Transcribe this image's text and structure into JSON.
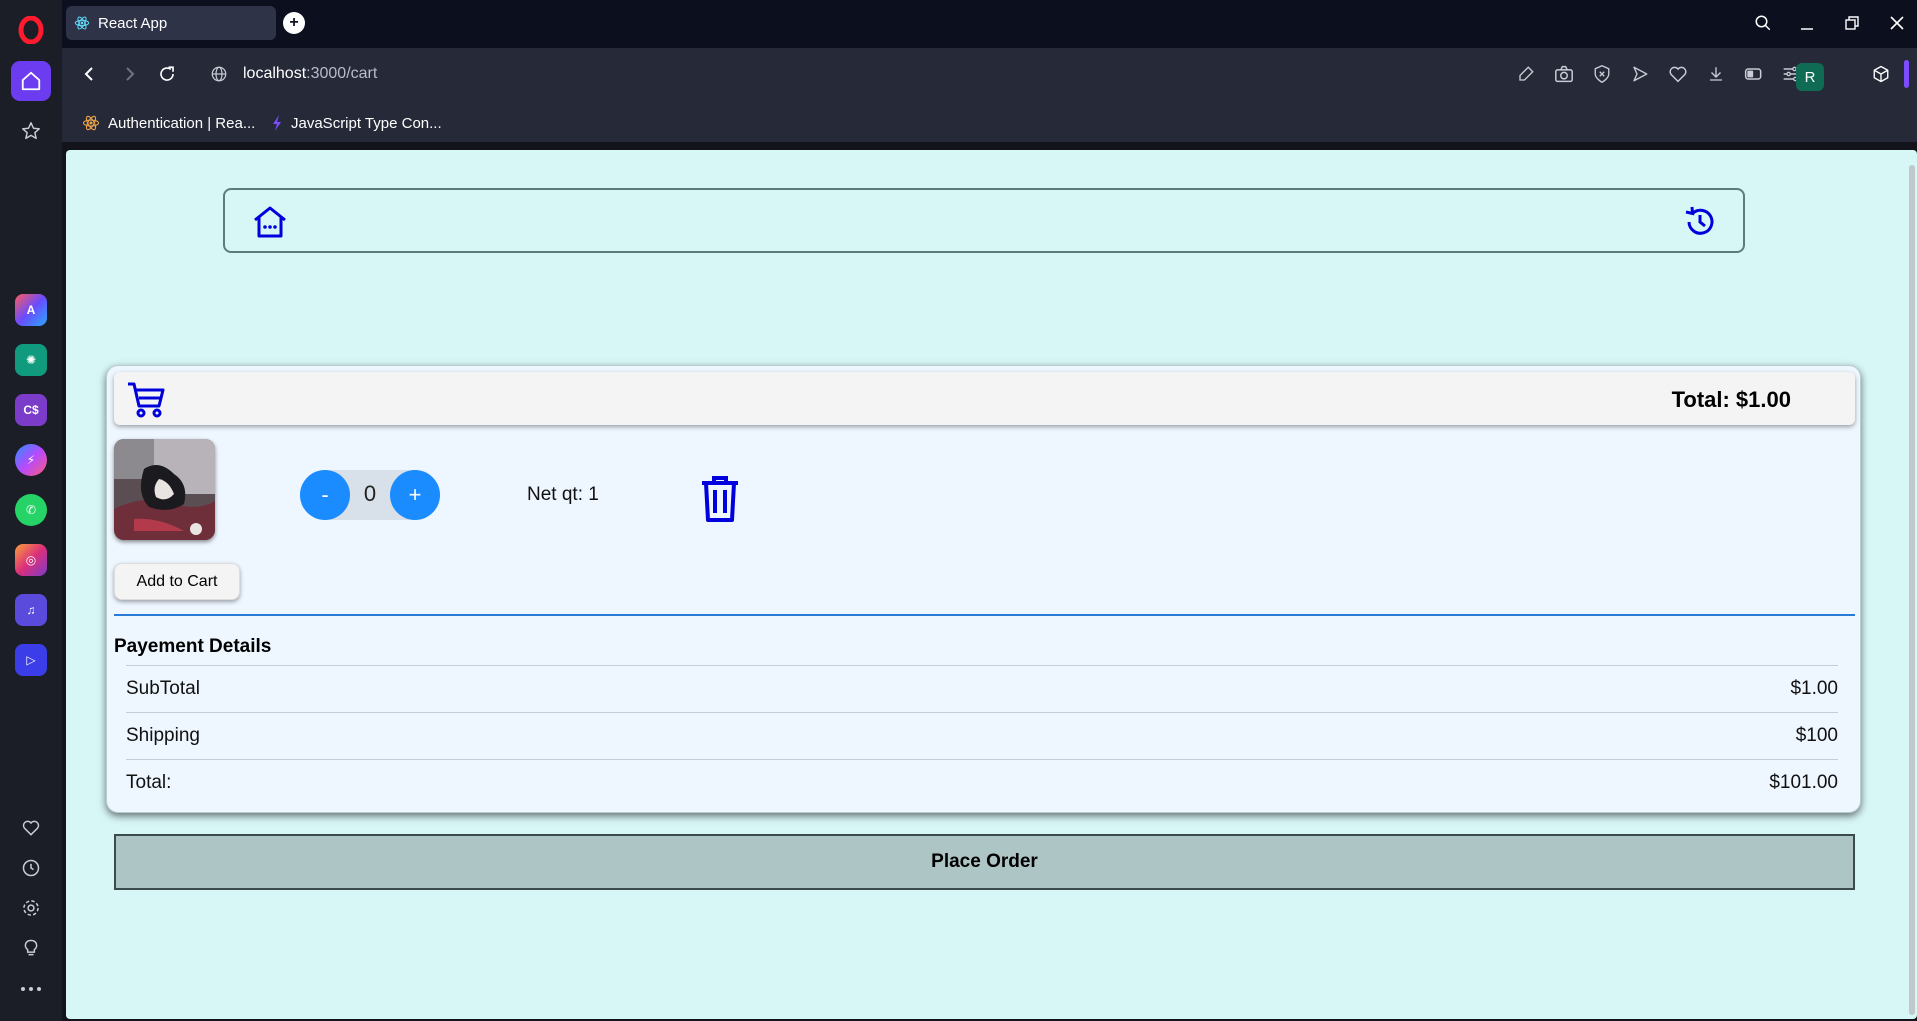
{
  "browser": {
    "tab_title": "React App",
    "url_host": "localhost",
    "url_path": ":3000/cart",
    "profile_initial": "R",
    "bookmarks": [
      {
        "label": "Authentication | Rea..."
      },
      {
        "label": "JavaScript Type Con..."
      }
    ]
  },
  "sidebar_apps": [
    {
      "name": "aria-icon",
      "color": "#3a66e8"
    },
    {
      "name": "chatgpt-icon",
      "color": "#109b7e"
    },
    {
      "name": "csharp-icon",
      "color": "#7a3cc9"
    },
    {
      "name": "messenger-icon",
      "color": "#7b5cff"
    },
    {
      "name": "whatsapp-icon",
      "color": "#25d366"
    },
    {
      "name": "instagram-icon",
      "color": "#dc2f7a"
    },
    {
      "name": "music-icon",
      "color": "#5b4bdc"
    },
    {
      "name": "player-icon",
      "color": "#3b3ee8"
    }
  ],
  "cart": {
    "header_total": "Total: $1.00",
    "item": {
      "add_to_cart_label": "Add to Cart",
      "minus_label": "-",
      "plus_label": "+",
      "quantity": "0",
      "net_qty": "Net qt: 1"
    },
    "payment": {
      "title": "Payement Details",
      "rows": [
        {
          "label": "SubTotal",
          "value": "$1.00"
        },
        {
          "label": "Shipping",
          "value": "$100"
        },
        {
          "label": "Total:",
          "value": "$101.00"
        }
      ]
    },
    "place_order_label": "Place Order"
  },
  "colors": {
    "page_bg": "#d7f6f6",
    "accent_blue": "#0000dd",
    "button_blue": "#1a8cff",
    "place_order_bg": "#aec5c6"
  }
}
